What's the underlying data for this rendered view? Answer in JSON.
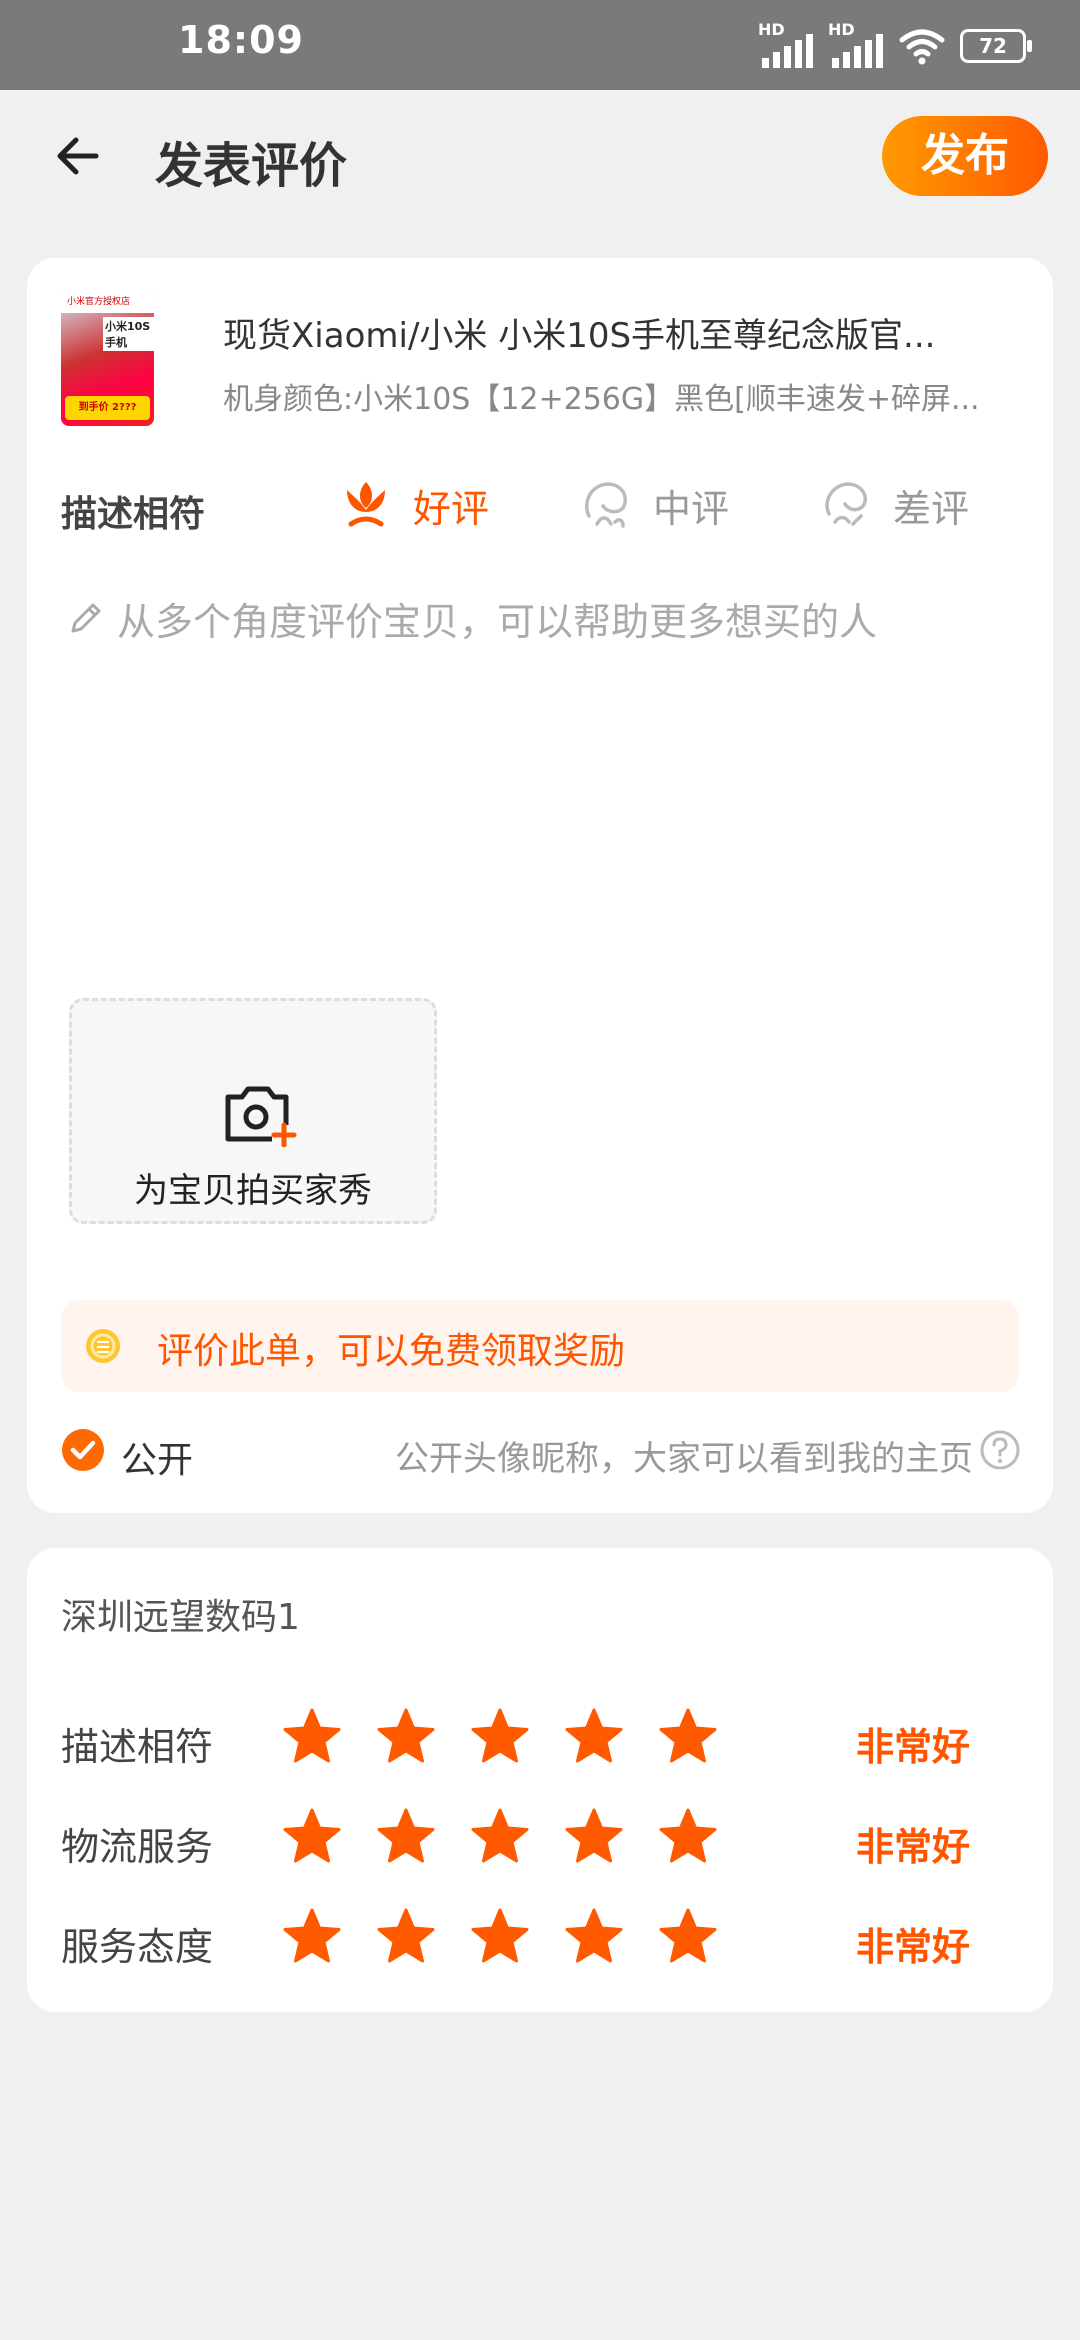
{
  "status_bar": {
    "time": "18:09",
    "signal_label": "HD",
    "battery": "72"
  },
  "header": {
    "title": "发表评价",
    "publish_label": "发布",
    "accent_color": "#ff5a00"
  },
  "product": {
    "title": "现货Xiaomi/小米 小米10S手机至尊纪念版官...",
    "spec": "机身颜色:小米10S【12+256G】黑色[顺丰速发+碎屏...",
    "thumb_store": "小米官方授权店",
    "thumb_model": "小米10S手机",
    "thumb_price": "到手价 2???"
  },
  "review": {
    "desc_label": "描述相符",
    "options": [
      {
        "label": "好评",
        "icon": "flower-icon",
        "selected": true
      },
      {
        "label": "中评",
        "icon": "neutral-face-icon",
        "selected": false
      },
      {
        "label": "差评",
        "icon": "sad-face-icon",
        "selected": false
      }
    ],
    "placeholder": "从多个角度评价宝贝，可以帮助更多想买的人",
    "photo_label": "为宝贝拍买家秀",
    "reward_text": "评价此单，可以免费领取奖励",
    "public_label": "公开",
    "public_hint": "公开头像昵称，大家可以看到我的主页"
  },
  "shop": {
    "name": "深圳远望数码1",
    "ratings": [
      {
        "label": "描述相符",
        "stars": 5,
        "text": "非常好"
      },
      {
        "label": "物流服务",
        "stars": 5,
        "text": "非常好"
      },
      {
        "label": "服务态度",
        "stars": 5,
        "text": "非常好"
      }
    ]
  }
}
